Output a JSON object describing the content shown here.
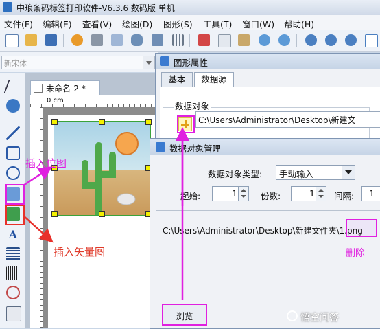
{
  "app": {
    "title": "中琅条码标签打印软件-V6.3.6 数码版 单机"
  },
  "menu": {
    "items": [
      "文件(F)",
      "编辑(E)",
      "查看(V)",
      "绘图(D)",
      "图形(S)",
      "工具(T)",
      "窗口(W)",
      "帮助(H)"
    ]
  },
  "toolbar": {
    "icons": [
      "new-icon",
      "open-icon",
      "save-icon",
      "settings-icon",
      "print-icon",
      "print-preview-icon",
      "database-icon",
      "layers-icon",
      "grid-icon",
      "cut-icon",
      "copy-icon",
      "paste-icon",
      "undo-icon",
      "redo-icon",
      "zoom-in-icon",
      "zoom-out-icon",
      "zoom-fit-icon",
      "fullscreen-icon"
    ]
  },
  "font": {
    "placeholder": "新宋体"
  },
  "document": {
    "tab_label": "未命名-2 *",
    "ruler_unit": "0 cm"
  },
  "annotations": {
    "insert_position": "插入位图",
    "insert_vector": "插入矢量图",
    "delete": "删除"
  },
  "props_dialog": {
    "title": "图形属性",
    "tabs": [
      "基本",
      "数据源"
    ],
    "group_label": "数据对象",
    "list_item": "C:\\Users\\Administrator\\Desktop\\新建文"
  },
  "dom_dialog": {
    "title": "数据对象管理",
    "type_label": "数据对象类型:",
    "type_value": "手动输入",
    "start_label": "起始:",
    "start_value": "1",
    "copies_label": "份数:",
    "copies_value": "1",
    "interval_label": "间隔:",
    "interval_value": "1",
    "path": "C:\\Users\\Administrator\\Desktop\\新建文件夹\\1.png",
    "browse_label": "浏览"
  },
  "watermark": {
    "text": "悟空问答"
  }
}
